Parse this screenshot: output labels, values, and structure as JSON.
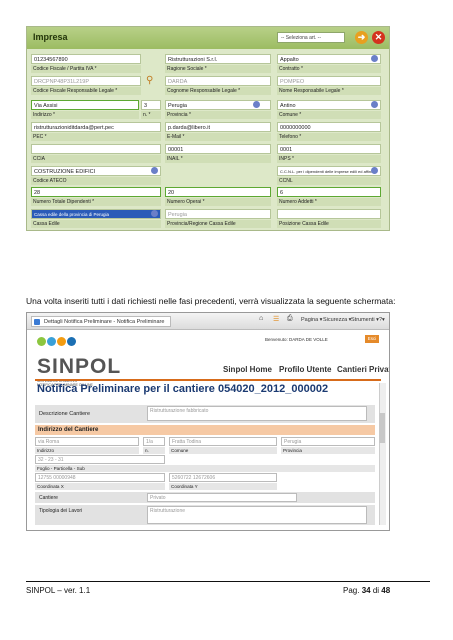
{
  "impresa_form": {
    "title": "Impresa",
    "select_value": "-- Seleziona art. --",
    "colors": {
      "header": "#9cbc62",
      "panel": "#dde8c8",
      "ok": "#e8a020",
      "close": "#d4321e"
    },
    "row1": {
      "v1": "01234567890",
      "v2": "Ristrutturazioni S.r.l.",
      "v3": "Appalto"
    },
    "row1_labels": {
      "l1": "Codice Fiscale / Partita IVA *",
      "l2": "Ragione Sociale *",
      "l3": "Contratto *"
    },
    "row2": {
      "v1": "DRCPNP48P31L219P",
      "v2": "DARDA",
      "v3": "POMPEO"
    },
    "row2_labels": {
      "l1": "Codice Fiscale Responsabile Legale *",
      "l2": "Cognome Responsabile Legale *",
      "l3": "Nome Responsabile Legale *"
    },
    "row3": {
      "v1": "Via Assisi",
      "v2": "3",
      "v3": "Perugia",
      "v4": "Antino"
    },
    "row3_labels": {
      "l1": "Indirizzo *",
      "l2": "n. *",
      "l3": "Provincia *",
      "l4": "Comune *"
    },
    "row4": {
      "v1": "ristrutturazioniditdarda@pert.pec",
      "v2": "p.darda@libero.it",
      "v3": "0000000000"
    },
    "row4_labels": {
      "l1": "PEC *",
      "l2": "E-Mail *",
      "l3": "Telefono *"
    },
    "row5": {
      "v2": "00001",
      "v3": "0001"
    },
    "row5_labels": {
      "l1": "CCIA",
      "l2": "INAIL *",
      "l3": "INPS *"
    },
    "row6": {
      "v1": "COSTRUZIONE EDIFICI",
      "v3": "C.C.N.L. per i dipendenti delle imprese edili ed affini"
    },
    "row6_labels": {
      "l1": "Codice ATECO",
      "l3": "CCNL"
    },
    "row7": {
      "v1": "28",
      "v2": "20",
      "v3": "6"
    },
    "row7_labels": {
      "l1": "Numero Totale Dipendenti *",
      "l2": "Numero Operai *",
      "l3": "Numero Addetti *"
    },
    "row8": {
      "v1": "Cassa edile della provincia di Perugia",
      "v2": "Perugia"
    },
    "row8_labels": {
      "l1": "Cassa Edile",
      "l2": "Provincia/Regione Cassa Edile",
      "l3": "Posizione Cassa Edile"
    }
  },
  "caption": "Una volta inseriti tutti i dati richiesti nelle fasi precedenti, verrà visualizzata la seguente schermata:",
  "browser": {
    "tab_title": "Dettagli Notifica Preliminare - Notifica Preliminare",
    "toolbar": {
      "pagina": "Pagina ▾",
      "sicurezza": "Sicurezza ▾",
      "strumenti": "Strumenti ▾",
      "help": "?▾"
    },
    "logo": "SINPOL",
    "logo_sub1": "SISTEMA INFORMATIVO",
    "logo_sub2": "NOTIFICA PRELIMINARE ON LINE",
    "logo_colors": [
      "#8cc63f",
      "#3aa0d8",
      "#f39c12",
      "#1b6fb3"
    ],
    "welcome": "Benvenuto:  DARDA  DE  VOLLE",
    "esci": "Esci",
    "nav": {
      "home": "Sinpol Home",
      "profilo": "Profilo Utente",
      "cantieri": "Cantieri Privati"
    },
    "notification_title": "Notifica Preliminare per il cantiere 054020_2012_000002",
    "descrizione_label": "Descrizione Cantiere",
    "descrizione_value": "Ristrutturazione fabbricato",
    "section_title": "Indirizzo del Cantiere",
    "indirizzo": {
      "v1": "via Roma",
      "v2": "1/a",
      "v3": "Fratta Todina",
      "v4": "Perugia"
    },
    "indirizzo_labels": {
      "l1": "Indirizzo",
      "l2": "n.",
      "l3": "Comune",
      "l4": "Provincia"
    },
    "foglio": {
      "v1": "32 - 23 - 31"
    },
    "foglio_label": "Foglio - Particella - Sub",
    "coord": {
      "v1": "12755 00000948",
      "v2": "5260722 12672606"
    },
    "coord_labels": {
      "l1": "Coordinata X",
      "l2": "Coordinata Y"
    },
    "cantiere": {
      "value": "Privato",
      "label": "Cantiere"
    },
    "tipologia": {
      "value": "Ristrutturazione",
      "label": "Tipologia dei Lavori"
    }
  },
  "footer": {
    "left": "SINPOL – ver. 1.1",
    "right_prefix": "Pag. ",
    "page": "34",
    "of": " di ",
    "total": "48"
  }
}
